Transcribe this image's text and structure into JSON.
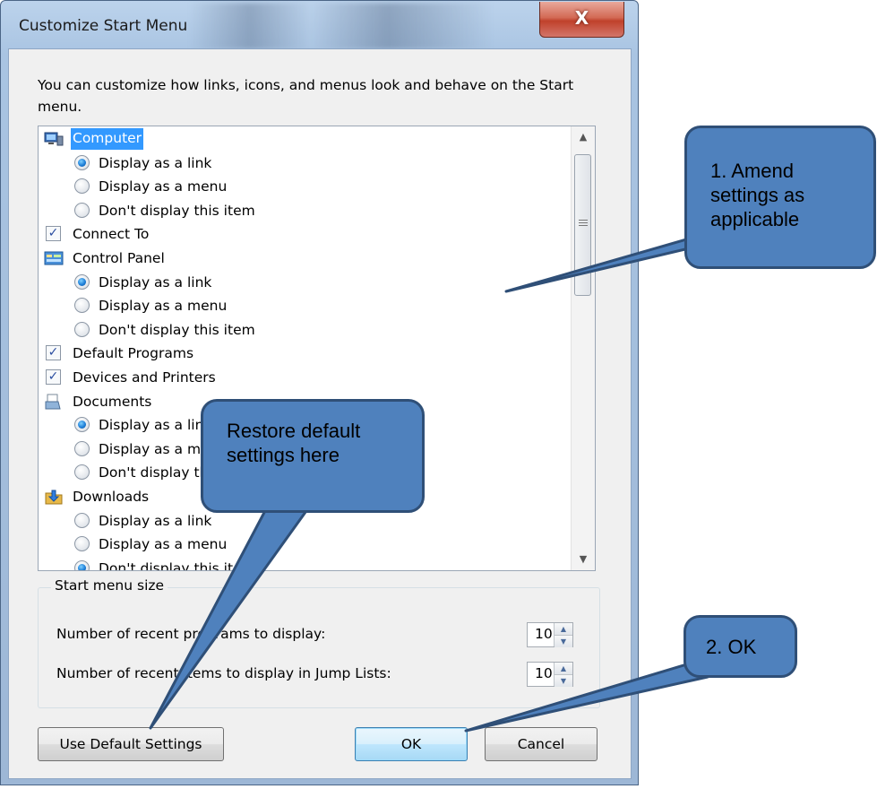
{
  "window": {
    "title": "Customize Start Menu",
    "close_glyph": "X"
  },
  "intro_text": "You can customize how links, icons, and menus look and behave on the Start menu.",
  "list": {
    "rows": [
      {
        "type": "category",
        "icon": "computer-icon",
        "label": "Computer",
        "selected": true
      },
      {
        "type": "radio",
        "label": "Display as a link",
        "checked": true
      },
      {
        "type": "radio",
        "label": "Display as a menu",
        "checked": false
      },
      {
        "type": "radio",
        "label": "Don't display this item",
        "checked": false
      },
      {
        "type": "checkbox",
        "label": "Connect To",
        "checked": true
      },
      {
        "type": "category",
        "icon": "control-panel-icon",
        "label": "Control Panel"
      },
      {
        "type": "radio",
        "label": "Display as a link",
        "checked": true
      },
      {
        "type": "radio",
        "label": "Display as a menu",
        "checked": false
      },
      {
        "type": "radio",
        "label": "Don't display this item",
        "checked": false
      },
      {
        "type": "checkbox",
        "label": "Default Programs",
        "checked": true
      },
      {
        "type": "checkbox",
        "label": "Devices and Printers",
        "checked": true
      },
      {
        "type": "category",
        "icon": "documents-icon",
        "label": "Documents"
      },
      {
        "type": "radio",
        "label": "Display as a link",
        "checked": true
      },
      {
        "type": "radio",
        "label": "Display as a menu",
        "checked": false
      },
      {
        "type": "radio",
        "label": "Don't display this item",
        "checked": false
      },
      {
        "type": "category",
        "icon": "downloads-icon",
        "label": "Downloads"
      },
      {
        "type": "radio",
        "label": "Display as a link",
        "checked": false
      },
      {
        "type": "radio",
        "label": "Display as a menu",
        "checked": false
      },
      {
        "type": "radio",
        "label": "Don't display this item",
        "checked": true
      }
    ]
  },
  "size_group": {
    "title": "Start menu size",
    "recent_programs_label": "Number of recent programs to display:",
    "recent_programs_value": "10",
    "jump_list_label": "Number of recent items to display in Jump Lists:",
    "jump_list_value": "10"
  },
  "buttons": {
    "use_default": "Use Default Settings",
    "ok": "OK",
    "cancel": "Cancel"
  },
  "callouts": {
    "amend": "1. Amend settings as applicable",
    "restore": "Restore default settings here",
    "ok": "2. OK"
  },
  "colors": {
    "callout_fill": "#4f81bd",
    "callout_border": "#2f4f77",
    "selection": "#3399ff"
  }
}
